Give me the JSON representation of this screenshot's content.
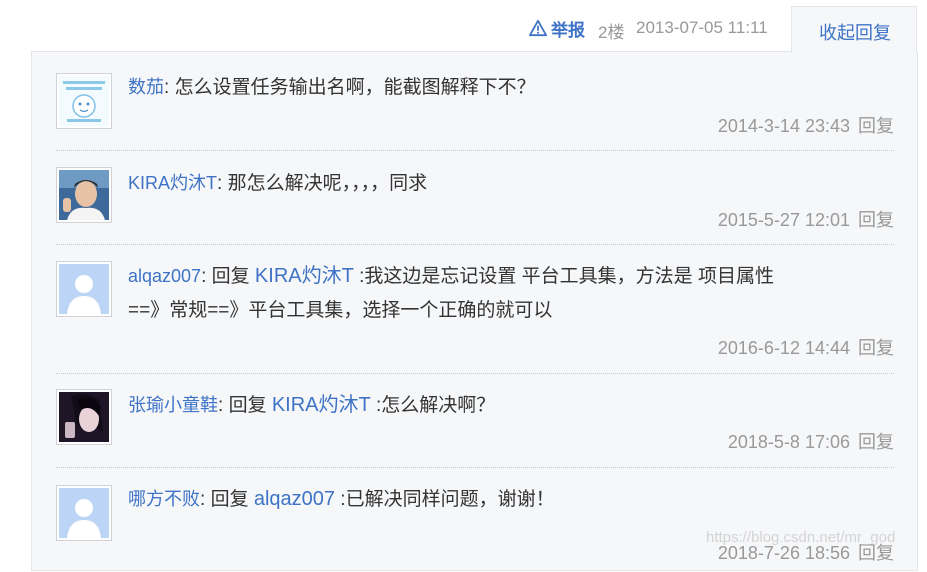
{
  "header": {
    "report_label": "举报",
    "floor": "2楼",
    "timestamp": "2013-07-05 11:11",
    "collapse_label": "收起回复"
  },
  "comments": [
    {
      "user": "数茄",
      "separator": ": ",
      "text": "怎么设置任务输出名啊，能截图解释下不？",
      "time": "2014-3-14 23:43",
      "reply": "回复"
    },
    {
      "user": "KIRA灼沐T",
      "separator": ": ",
      "text": "那怎么解决呢，，，，同求",
      "time": "2015-5-27 12:01",
      "reply": "回复"
    },
    {
      "user": "alqaz007",
      "separator": ": ",
      "prefix": "回复 ",
      "mention": "KIRA灼沐T",
      "text": " :我这边是忘记设置 平台工具集，方法是 项目属性",
      "text2": "==》常规==》平台工具集，选择一个正确的就可以",
      "time": "2016-6-12 14:44",
      "reply": "回复"
    },
    {
      "user": "张瑜小童鞋",
      "separator": ": ",
      "prefix": "回复 ",
      "mention": "KIRA灼沐T",
      "text": " :怎么解决啊？",
      "time": "2018-5-8 17:06",
      "reply": "回复"
    },
    {
      "user": "哪方不败",
      "separator": ": ",
      "prefix": "回复 ",
      "mention": "alqaz007",
      "text": " :已解决同样问题，谢谢！",
      "time": "2018-7-26 18:56",
      "reply": "回复"
    }
  ],
  "watermark": "https://blog.csdn.net/mr_god",
  "colors": {
    "link": "#3e73c6",
    "meta": "#999999",
    "panel_bg": "#f6f7f9",
    "border": "#e3e6ea"
  }
}
